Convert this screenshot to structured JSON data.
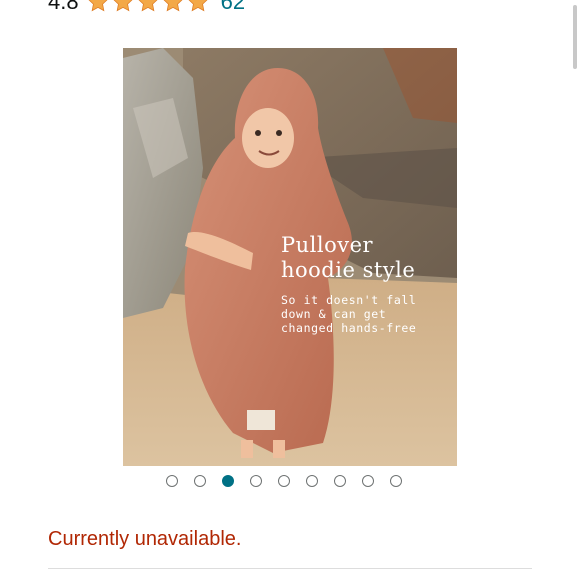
{
  "rating": {
    "value": "4.8",
    "stars": 5,
    "star_color": "#f3a847",
    "review_count": "62"
  },
  "product_image": {
    "overlay_title_line1": "Pullover",
    "overlay_title_line2": "hoodie style",
    "overlay_sub_line1": "So it doesn't fall",
    "overlay_sub_line2": "down & can get",
    "overlay_sub_line3": "changed hands-free"
  },
  "carousel": {
    "total_dots": 9,
    "active_index": 2,
    "active_color": "#007185"
  },
  "availability": {
    "text": "Currently unavailable.",
    "color": "#b12704"
  }
}
